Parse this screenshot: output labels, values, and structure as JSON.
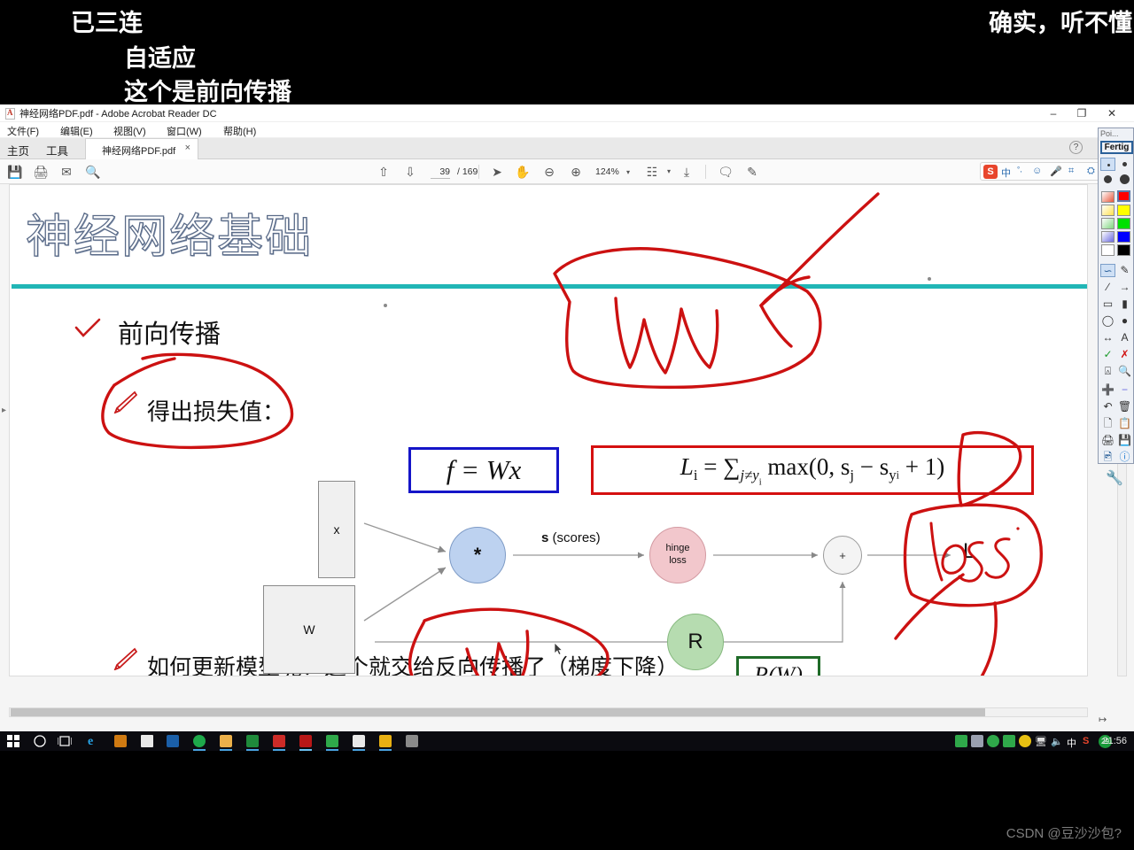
{
  "danmaku": [
    {
      "id": "dm0",
      "text": "已三连"
    },
    {
      "id": "dm1",
      "text": "自适应"
    },
    {
      "id": "dm2",
      "text": "这个是前向传播"
    },
    {
      "id": "dm3",
      "text": "确实，听不懂"
    }
  ],
  "window": {
    "title": "神经网络PDF.pdf - Adobe Acrobat Reader DC",
    "minimize": "–",
    "maximize": "❐",
    "close": "✕"
  },
  "menubar": [
    "文件(F)",
    "编辑(E)",
    "视图(V)",
    "窗口(W)",
    "帮助(H)"
  ],
  "tabbar": {
    "home": "主页",
    "tools": "工具",
    "doc_tab": "神经网络PDF.pdf",
    "close_tab": "×",
    "help": "?"
  },
  "toolbar": {
    "save_icon": "save-icon",
    "print_icon": "print-icon",
    "email_icon": "email-icon",
    "search_icon": "search-icon",
    "prev_page_icon": "arrow-up-circle-icon",
    "next_page_icon": "arrow-down-circle-icon",
    "page_current": "39",
    "page_total": "/ 169",
    "select_icon": "cursor-arrow-icon",
    "hand_icon": "hand-icon",
    "zoom_out_icon": "minus-circle-icon",
    "zoom_in_icon": "plus-circle-icon",
    "zoom_value": "124%",
    "zoom_caret": "▾",
    "fitpage_icon": "fit-page-icon",
    "fitpage_caret": "▾",
    "scroll_icon": "scroll-mode-icon",
    "comment_icon": "comment-icon",
    "highlight_icon": "highlight-icon"
  },
  "ime": {
    "logo": "S",
    "mode": "中",
    "punct": "°,",
    "emoji": "☺",
    "mic": "⌨",
    "keyboard": "⌗",
    "toolbox": "⛭"
  },
  "slide": {
    "title": "神经网络基础",
    "forward_prop": "前向传播",
    "loss_line": "得出损失值：",
    "bottom_line": "如何更新模型呢？这个就交给反向传播了（梯度下降）",
    "check_icon": "check-mark-icon",
    "pencil_icon": "pencil-icon"
  },
  "diagram": {
    "box_x": "x",
    "box_W": "W",
    "node_mul": "*",
    "node_hinge_line1": "hinge",
    "node_hinge_line2": "loss",
    "node_R": "R",
    "node_plus": "+",
    "node_L": "L",
    "scores_label_bold": "s",
    "scores_label_rest": " (scores)",
    "formula_f": "f = Wx",
    "formula_L_prefix": "L",
    "formula_L_sub": "i",
    "formula_L_body": " = ∑",
    "formula_L_sum_sub": "j≠y",
    "formula_L_sum_sub2": "i",
    "formula_L_tail": " max(0, s",
    "formula_L_tail_sub": "j",
    "formula_L_tail2": " − s",
    "formula_L_tail_sub2": "y",
    "formula_L_tail_sub3": "i",
    "formula_L_tail3": " + 1)",
    "formula_R": "R(W)"
  },
  "annotation_panel": {
    "title": "Poi...",
    "done_button": "Fertig",
    "colors": [
      "#e8553a",
      "#ff0000",
      "#ffe14d",
      "#ffff00",
      "#7fd67f",
      "#00e000",
      "#6a6ae0",
      "#0000ff",
      "#ffffff",
      "#000000"
    ],
    "tools": [
      "freehand-icon",
      "eraser-icon",
      "line-icon",
      "arrow-icon",
      "rectangle-icon",
      "filled-rectangle-icon",
      "ellipse-icon",
      "filled-ellipse-icon",
      "double-arrow-icon",
      "text-icon",
      "check-green-icon",
      "cross-red-icon",
      "crop-icon",
      "magnify-icon",
      "plus-icon",
      "minus-icon",
      "undo-icon",
      "trash-icon",
      "new-page-icon",
      "copy-icon",
      "print-icon",
      "save-icon",
      "image-icon",
      "info-icon"
    ]
  },
  "taskbar": {
    "start_icon": "windows-start-icon",
    "cortana_icon": "cortana-circle-icon",
    "taskview_icon": "task-view-icon",
    "apps": [
      "edge-icon",
      "store-icon",
      "mail-icon",
      "wechat-icon",
      "browser-icon",
      "explorer-icon",
      "excel-icon",
      "wps-icon",
      "acrobat-icon",
      "recorder-icon",
      "app-icon",
      "editor-icon",
      "media-icon"
    ],
    "tray": [
      "net-icon",
      "app-tray-icon",
      "browser-tray-icon",
      "shield-icon",
      "update-icon",
      "display-icon",
      "volume-icon"
    ],
    "ime_mode": "中",
    "sogou": "S",
    "badge": "29",
    "clock": "21:56"
  },
  "watermark": "CSDN @豆沙沙包?",
  "colors": {
    "ink": "#cc1111",
    "rule": "#21b6b6",
    "blue_box": "#1515c8",
    "red_box": "#d51010",
    "green_box": "#1f6b28"
  }
}
